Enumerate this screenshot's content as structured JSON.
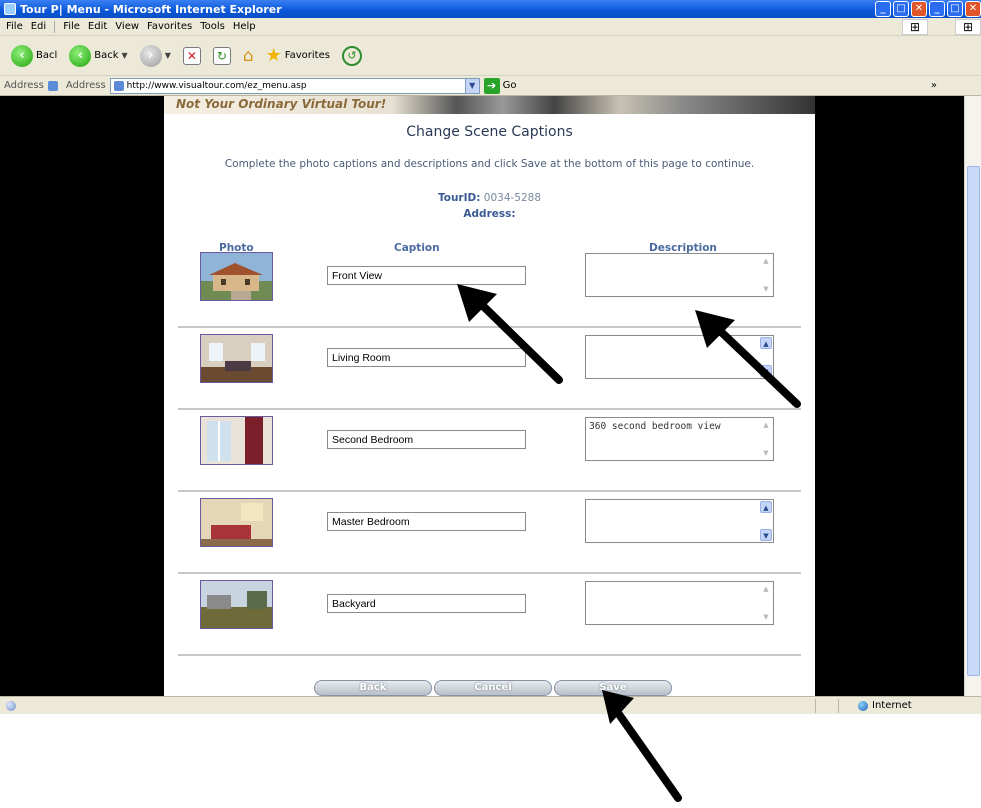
{
  "window": {
    "title": "Tour P| Menu - Microsoft Internet Explorer"
  },
  "menubar": {
    "items": [
      "File",
      "Edi",
      "File",
      "Edit",
      "View",
      "Favorites",
      "Tools",
      "Help"
    ]
  },
  "toolbar": {
    "back_short": "Bacl",
    "back_label": "Back",
    "favorites_label": "Favorites"
  },
  "addressbar": {
    "label1": "Address",
    "label2": "Address",
    "url": "http://www.visualtour.com/ez_menu.asp",
    "go_label": "Go",
    "more": "»"
  },
  "banner": {
    "text": "Not Your Ordinary Virtual Tour!"
  },
  "page": {
    "title": "Change Scene Captions",
    "instructions": "Complete the photo captions and descriptions and click Save at the bottom of this page to continue.",
    "tourid_label": "TourID:",
    "tourid_value": "0034-5288",
    "address_label": "Address:"
  },
  "columns": {
    "photo": "Photo",
    "caption": "Caption",
    "description": "Description"
  },
  "scenes": [
    {
      "caption": "Front View",
      "description": ""
    },
    {
      "caption": "Living Room",
      "description": ""
    },
    {
      "caption": "Second Bedroom",
      "description": "360 second bedroom view"
    },
    {
      "caption": "Master Bedroom",
      "description": ""
    },
    {
      "caption": "Backyard",
      "description": ""
    }
  ],
  "buttons": {
    "back": "Back",
    "cancel": "Cancel",
    "save": "Save"
  },
  "status": {
    "zone": "Internet"
  },
  "colors": {
    "title_blue": "#0a57d8",
    "chrome": "#ece9d8",
    "heading": "#4a6aa0"
  }
}
